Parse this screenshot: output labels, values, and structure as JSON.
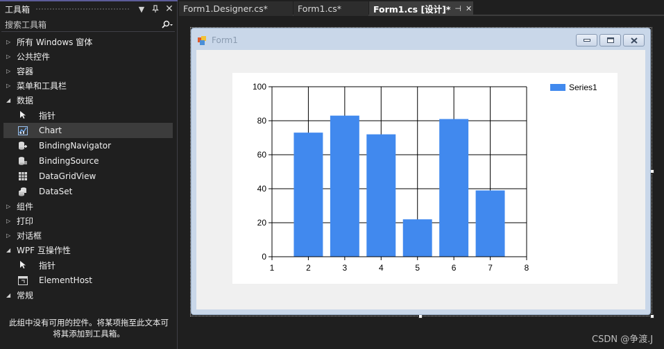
{
  "toolbox": {
    "title": "工具箱",
    "search_placeholder": "搜索工具箱",
    "categories": [
      {
        "label": "所有 Windows 窗体",
        "expanded": false
      },
      {
        "label": "公共控件",
        "expanded": false
      },
      {
        "label": "容器",
        "expanded": false
      },
      {
        "label": "菜单和工具栏",
        "expanded": false
      },
      {
        "label": "数据",
        "expanded": true,
        "items": [
          {
            "label": "指针",
            "icon": "pointer-icon"
          },
          {
            "label": "Chart",
            "icon": "chart-icon",
            "selected": true
          },
          {
            "label": "BindingNavigator",
            "icon": "binding-navigator-icon"
          },
          {
            "label": "BindingSource",
            "icon": "binding-source-icon"
          },
          {
            "label": "DataGridView",
            "icon": "datagridview-icon"
          },
          {
            "label": "DataSet",
            "icon": "dataset-icon"
          }
        ]
      },
      {
        "label": "组件",
        "expanded": false
      },
      {
        "label": "打印",
        "expanded": false
      },
      {
        "label": "对话框",
        "expanded": false
      },
      {
        "label": "WPF 互操作性",
        "expanded": true,
        "items": [
          {
            "label": "指针",
            "icon": "pointer-icon"
          },
          {
            "label": "ElementHost",
            "icon": "elementhost-icon"
          }
        ]
      },
      {
        "label": "常规",
        "expanded": true,
        "items": []
      }
    ],
    "empty_message": "此组中没有可用的控件。将某项拖至此文本可将其添加到工具箱。"
  },
  "tabs": [
    {
      "label": "Form1.Designer.cs*",
      "active": false
    },
    {
      "label": "Form1.cs*",
      "active": false
    },
    {
      "label": "Form1.cs [设计]*",
      "active": true
    }
  ],
  "form": {
    "title": "Form1"
  },
  "colors": {
    "bar": "#4189ee",
    "form_frame": "#c9d7e9",
    "tab_active": "#3d3d3d"
  },
  "chart_data": {
    "type": "bar",
    "categories": [
      "2",
      "3",
      "4",
      "5",
      "6",
      "7"
    ],
    "x": [
      2,
      3,
      4,
      5,
      6,
      7
    ],
    "series": [
      {
        "name": "Series1",
        "values": [
          73,
          83,
          72,
          22,
          81,
          39
        ]
      }
    ],
    "xlim": [
      1,
      8
    ],
    "ylim": [
      0,
      100
    ],
    "xticks": [
      1,
      2,
      3,
      4,
      5,
      6,
      7,
      8
    ],
    "yticks": [
      0,
      20,
      40,
      60,
      80,
      100
    ],
    "grid": true,
    "legend_position": "top-right",
    "title": "",
    "xlabel": "",
    "ylabel": ""
  },
  "watermark": "CSDN @争渡.J"
}
